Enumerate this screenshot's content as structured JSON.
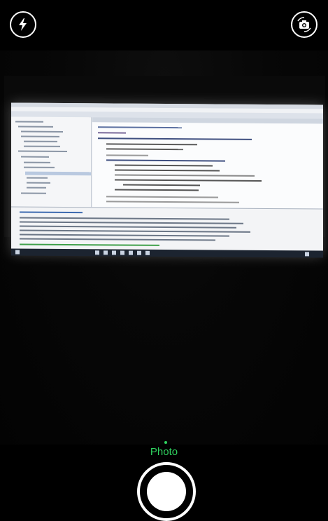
{
  "controls": {
    "flash_icon": "flash-auto-icon",
    "switch_camera_icon": "switch-camera-icon"
  },
  "mode": {
    "label": "Photo"
  },
  "shutter": {
    "icon": "shutter-button"
  },
  "colors": {
    "accent": "#2fd35f",
    "background": "#000000"
  }
}
